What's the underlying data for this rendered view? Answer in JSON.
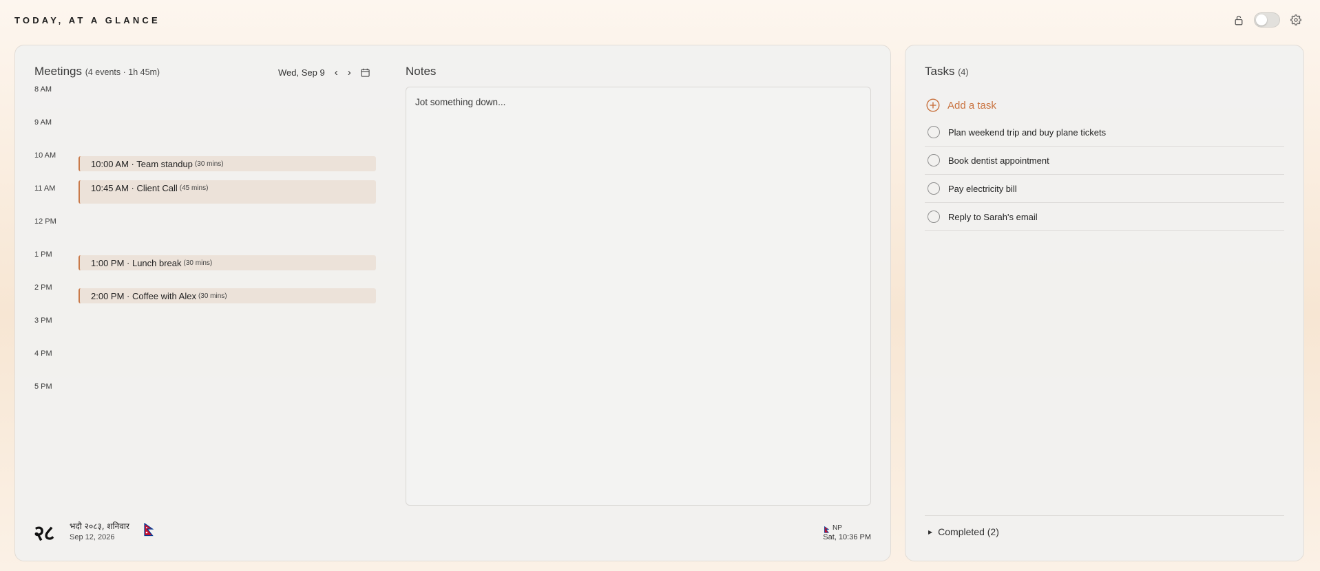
{
  "header": {
    "title": "TODAY, AT A GLANCE"
  },
  "meetings": {
    "title": "Meetings",
    "summary": "(4 events · 1h 45m)",
    "date": "Wed, Sep 9",
    "prev_label": "‹",
    "next_label": "›",
    "hours": [
      "8 AM",
      "9 AM",
      "10 AM",
      "11 AM",
      "12 PM",
      "1 PM",
      "2 PM",
      "3 PM",
      "4 PM",
      "5 PM"
    ],
    "events": [
      {
        "label": "10:00 AM · Team standup",
        "duration": "(30 mins)"
      },
      {
        "label": "10:45 AM · Client Call",
        "duration": "(45 mins)"
      },
      {
        "label": "1:00 PM · Lunch break",
        "duration": "(30 mins)"
      },
      {
        "label": "2:00 PM · Coffee with Alex",
        "duration": "(30 mins)"
      }
    ]
  },
  "notes": {
    "title": "Notes",
    "placeholder": "Jot something down..."
  },
  "footer": {
    "nepali_day": "२८",
    "nepali_date": "भदौ २०८३, शनिवार",
    "english_date": "Sep 12, 2026",
    "region": "NP",
    "local_time": "Sat, 10:36 PM"
  },
  "tasks": {
    "title": "Tasks",
    "count": "(4)",
    "add_label": "Add a task",
    "items": [
      "Plan weekend trip and buy plane tickets",
      "Book dentist appointment",
      "Pay electricity bill",
      "Reply to Sarah's email"
    ],
    "completed_label": "Completed (2)"
  },
  "colors": {
    "accent": "#c9723f",
    "event_bg": "#ece2d9",
    "nepal_red": "#c8102e",
    "nepal_blue": "#003893"
  }
}
